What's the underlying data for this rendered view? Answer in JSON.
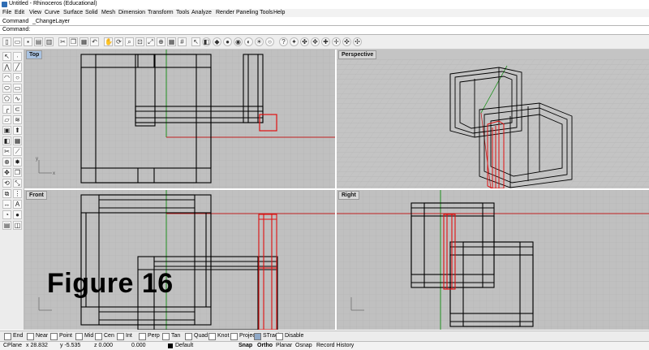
{
  "window": {
    "title": "Untitled - Rhinoceros (Educational)"
  },
  "menu": [
    "File",
    "Edit",
    "View",
    "Curve",
    "Surface",
    "Solid",
    "Mesh",
    "Dimension",
    "Transform",
    "Tools",
    "Analyze",
    "Render",
    "Paneling Tools",
    "Help"
  ],
  "command": {
    "history_label": "Command",
    "history_value": "_ChangeLayer",
    "prompt_label": "Command:"
  },
  "viewports": {
    "top": "Top",
    "perspective": "Perspective",
    "front": "Front",
    "right": "Right"
  },
  "axis_labels": {
    "x": "x",
    "y": "y",
    "z": "z"
  },
  "caption": "Figure 16",
  "osnaps": [
    {
      "label": "End",
      "checked": false
    },
    {
      "label": "Near",
      "checked": false
    },
    {
      "label": "Point",
      "checked": false
    },
    {
      "label": "Mid",
      "checked": false
    },
    {
      "label": "Cen",
      "checked": false
    },
    {
      "label": "Int",
      "checked": false
    },
    {
      "label": "Perp",
      "checked": false
    },
    {
      "label": "Tan",
      "checked": false
    },
    {
      "label": "Quad",
      "checked": false
    },
    {
      "label": "Knot",
      "checked": false
    },
    {
      "label": "Project",
      "checked": false
    },
    {
      "label": "STrack",
      "checked": true
    },
    {
      "label": "Disable",
      "checked": false
    }
  ],
  "status": {
    "cplane": "CPlane",
    "x": "x 28.832",
    "y": "y -5.535",
    "z": "z 0.000",
    "extra": "0.000",
    "layer": "Default",
    "snap": "Snap",
    "ortho": "Ortho",
    "planar": "Planar",
    "osnap": "Osnap",
    "record": "Record History"
  },
  "colors": {
    "viewport_bg": "#c0c0c0",
    "grid": "#b0b0b0",
    "wire": "#000000",
    "selected": "#e01010",
    "x_axis": "#c02020",
    "y_axis": "#209020"
  }
}
